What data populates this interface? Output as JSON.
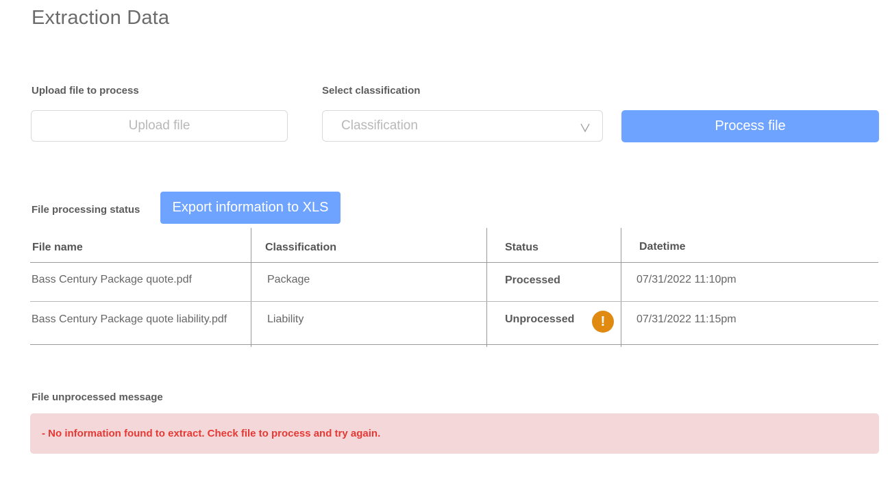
{
  "page": {
    "title": "Extraction Data"
  },
  "upload": {
    "label": "Upload file to process",
    "button_label": "Upload file"
  },
  "classification": {
    "label": "Select classification",
    "placeholder": "Classification"
  },
  "process": {
    "button_label": "Process file"
  },
  "status_section": {
    "label": "File processing status",
    "export_button_label": "Export information to XLS"
  },
  "table": {
    "columns": [
      "File name",
      "Classification",
      "Status",
      "Datetime"
    ],
    "rows": [
      {
        "file_name": "Bass Century Package quote.pdf",
        "classification": "Package",
        "status": "Processed",
        "datetime": "07/31/2022 11:10pm",
        "warning": false
      },
      {
        "file_name": "Bass Century Package quote liability.pdf",
        "classification": "Liability",
        "status": "Unprocessed",
        "datetime": "07/31/2022 11:15pm",
        "warning": true,
        "warning_icon": "exclamation-circle-icon",
        "warning_glyph": "!"
      }
    ]
  },
  "message_section": {
    "label": "File unprocessed message",
    "message": "- No information found to extract. Check file to process and try again."
  },
  "colors": {
    "accent": "#6ea3ff",
    "warning": "#e08a12",
    "error_text": "#e53935",
    "error_background": "#f4d7d9"
  }
}
